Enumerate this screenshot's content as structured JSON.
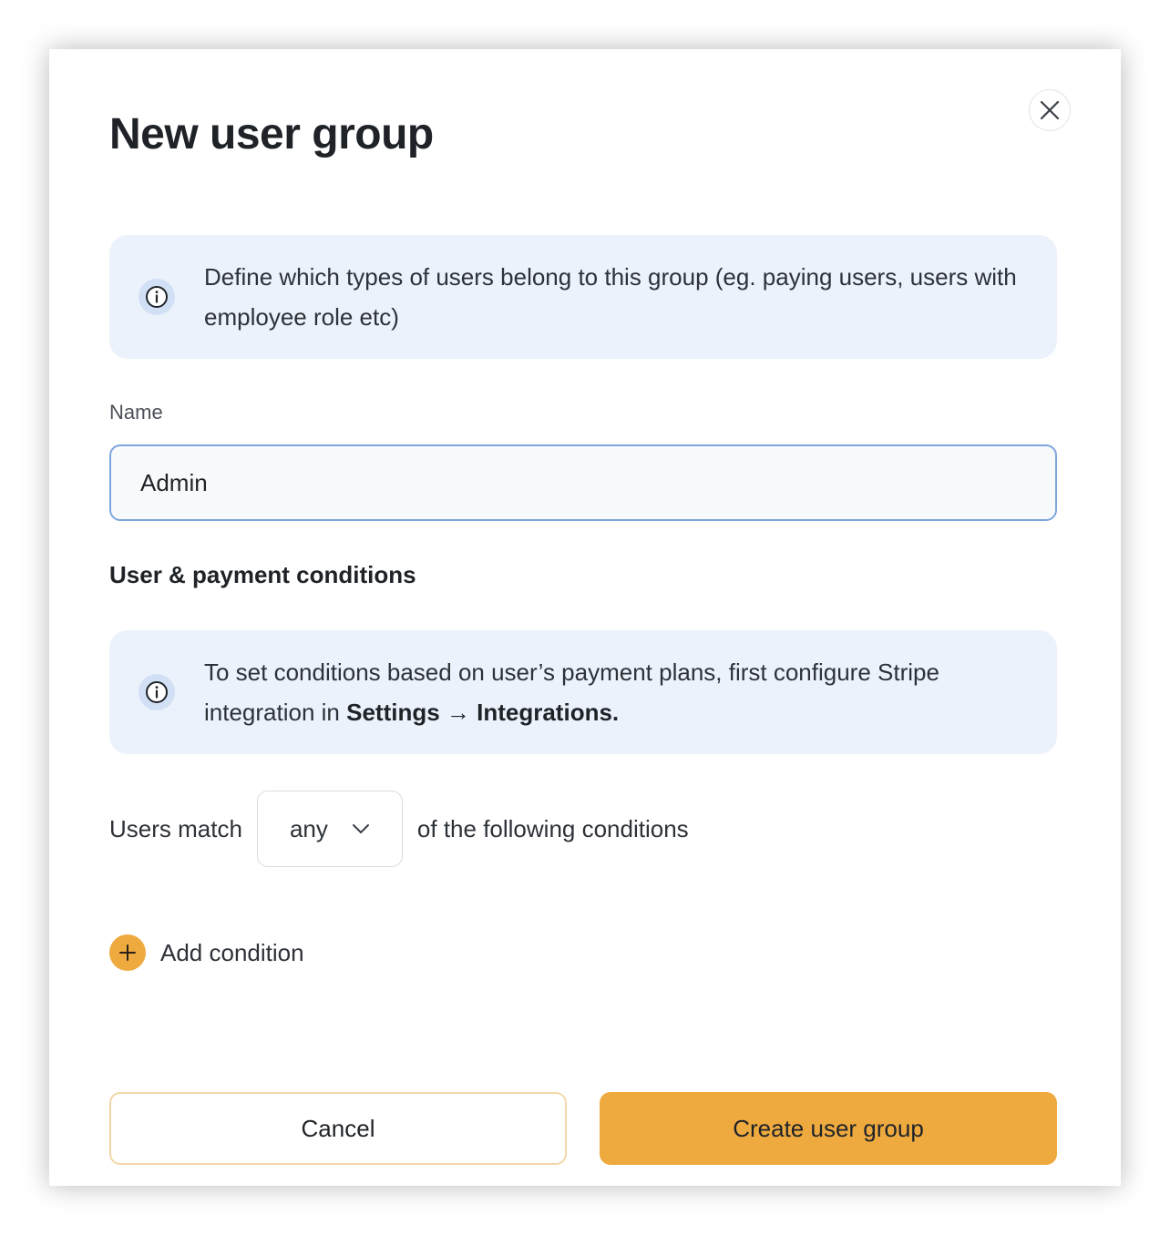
{
  "modal": {
    "title": "New user group",
    "close_icon": "close-icon"
  },
  "info_group": {
    "icon": "info-icon",
    "text": "Define which types of users belong to this group (eg. paying users, users with employee role etc)"
  },
  "name_field": {
    "label": "Name",
    "value": "Admin"
  },
  "conditions": {
    "heading": "User & payment conditions",
    "info": {
      "icon": "info-icon",
      "text_before": "To set conditions based on user’s payment plans, first configure Stripe integration in ",
      "bold": "Settings → Integrations."
    },
    "match_prefix": "Users match",
    "match_value": "any",
    "match_suffix": "of the following conditions",
    "add_label": "Add condition"
  },
  "footer": {
    "cancel_label": "Cancel",
    "create_label": "Create user group"
  },
  "colors": {
    "accent": "#efaa3f",
    "info_bg": "#ecf2fb",
    "input_border": "#7ea6dc"
  }
}
